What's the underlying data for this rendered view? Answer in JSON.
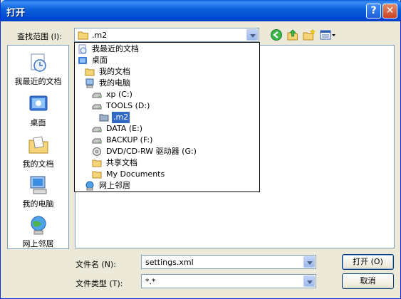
{
  "window": {
    "title": "打开",
    "help_glyph": "?",
    "close_glyph": "✕"
  },
  "lookin": {
    "label": "查找范围 (I):",
    "value": ".m2"
  },
  "places": [
    {
      "label": "我最近的文档",
      "icon": "recent-documents-icon"
    },
    {
      "label": "桌面",
      "icon": "desktop-icon"
    },
    {
      "label": "我的文档",
      "icon": "my-documents-icon"
    },
    {
      "label": "我的电脑",
      "icon": "my-computer-icon"
    },
    {
      "label": "网上邻居",
      "icon": "network-places-icon"
    }
  ],
  "dropdown_items": [
    {
      "label": "我最近的文档",
      "icon": "recent-documents-icon"
    },
    {
      "label": "桌面",
      "icon": "desktop-icon"
    },
    {
      "label": "我的文档",
      "icon": "folder-icon"
    },
    {
      "label": "我的电脑",
      "icon": "computer-icon"
    },
    {
      "label": "xp  (C:)",
      "icon": "drive-icon"
    },
    {
      "label": "TOOLS  (D:)",
      "icon": "drive-icon"
    },
    {
      "label": ".m2",
      "icon": "folder-open-icon",
      "selected": true
    },
    {
      "label": "DATA  (E:)",
      "icon": "drive-icon"
    },
    {
      "label": "BACKUP  (F:)",
      "icon": "drive-icon"
    },
    {
      "label": "DVD/CD-RW 驱动器  (G:)",
      "icon": "cd-drive-icon"
    },
    {
      "label": "共享文档",
      "icon": "folder-icon"
    },
    {
      "label": "My Documents",
      "icon": "folder-icon"
    },
    {
      "label": "网上邻居",
      "icon": "network-icon"
    }
  ],
  "filename": {
    "label": "文件名 (N):",
    "value": "settings.xml"
  },
  "filetype": {
    "label": "文件类型 (T):",
    "value": "*.*"
  },
  "buttons": {
    "open": "打开 (O)",
    "cancel": "取消"
  },
  "colors": {
    "title_bar": "#0a5fd8",
    "dialog_bg": "#ece9d8",
    "selection": "#316ac5"
  }
}
